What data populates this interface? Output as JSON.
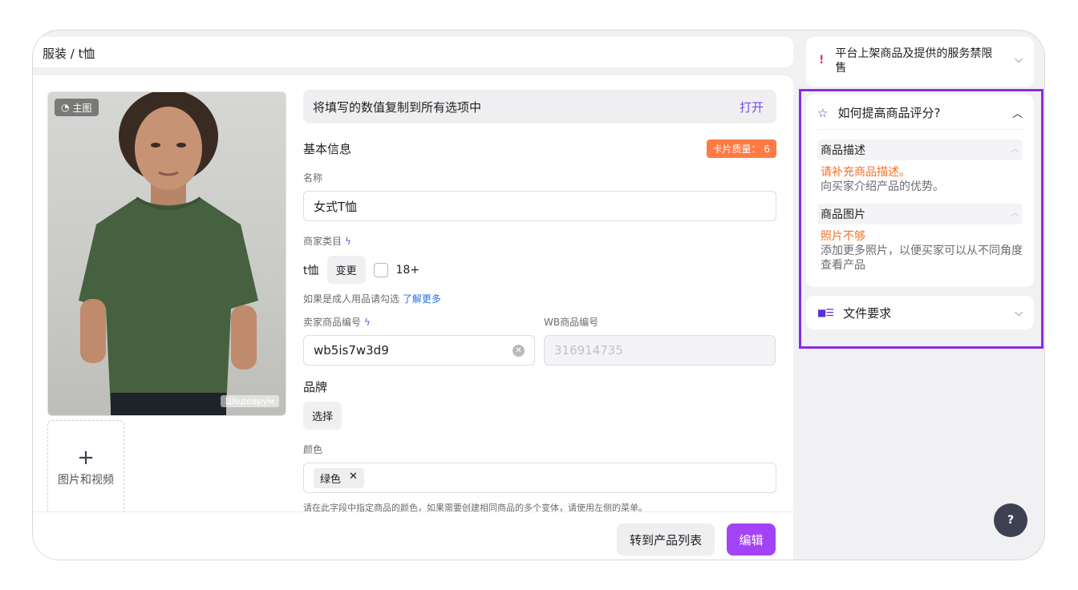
{
  "breadcrumb": "服装 / t恤",
  "photo": {
    "badge": "主图",
    "watermark": "Шедеврум"
  },
  "add_media": {
    "plus": "+",
    "label": "图片和视频"
  },
  "copy_bar": {
    "text": "将填写的数值复制到所有选项中",
    "action": "打开"
  },
  "basic_info": {
    "title": "基本信息",
    "quality_badge": "卡片质量： 6"
  },
  "name": {
    "label": "名称",
    "value": "女式T恤"
  },
  "category": {
    "label": "商家类目",
    "value": "t恤",
    "change_button": "变更",
    "adult_label": "18+",
    "hint": "如果是成人用品请勾选",
    "hint_link": "了解更多"
  },
  "seller_sku": {
    "label": "卖家商品编号",
    "value": "wb5is7w3d9"
  },
  "wb_sku": {
    "label": "WB商品编号",
    "value": "316914735"
  },
  "brand": {
    "label": "品牌",
    "button": "选择"
  },
  "color": {
    "label": "颜色",
    "tag": "绿色",
    "tag_remove": "✕",
    "hint": "请在此字段中指定商品的颜色，如果需要创建相同商品的多个变体，请使用左侧的菜单。"
  },
  "footer": {
    "secondary_button": "转到产品列表",
    "primary_button": "编辑"
  },
  "side": {
    "warning": {
      "mark": "!",
      "text": "平台上架商品及提供的服务禁限售"
    },
    "rating": {
      "title": "如何提高商品评分?",
      "items": [
        {
          "title": "商品描述",
          "warning": "请补充商品描述。",
          "desc": "向买家介绍产品的优势。"
        },
        {
          "title": "商品图片",
          "warning": "照片不够",
          "desc": "添加更多照片，以便买家可以从不同角度查看产品"
        }
      ]
    },
    "files": {
      "title": "文件要求"
    }
  },
  "help": "?",
  "colors": {
    "accent": "#a443f5",
    "highlight": "#8a2be2",
    "warning": "#f3712a",
    "badge": "#ff7a45"
  }
}
